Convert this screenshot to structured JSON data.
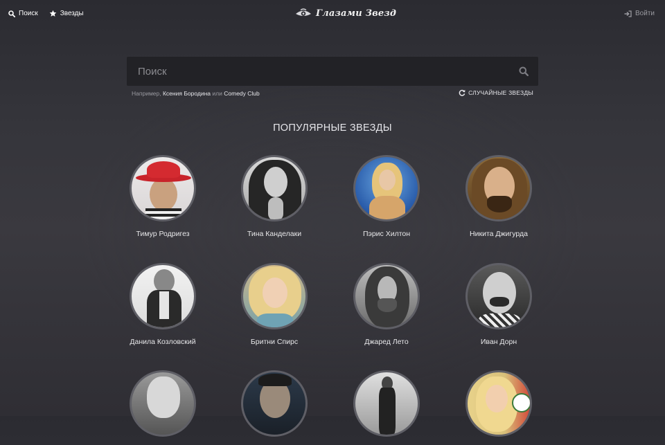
{
  "nav": {
    "search_label": "Поиск",
    "stars_label": "Звезды",
    "logo_text": "Глазами Звезд",
    "login_label": "Войти"
  },
  "search": {
    "placeholder": "Поиск",
    "hint_prefix": "Например,",
    "hint_example1": "Ксения Бородина",
    "hint_or": "или",
    "hint_example2": "Comedy Club",
    "random_label": "СЛУЧАЙНЫЕ ЗВЕЗДЫ"
  },
  "popular": {
    "title": "ПОПУЛЯРНЫЕ ЗВЕЗДЫ",
    "stars": [
      {
        "name": "Тимур Родригез"
      },
      {
        "name": "Тина Канделаки"
      },
      {
        "name": "Пэрис Хилтон"
      },
      {
        "name": "Никита Джигурда"
      },
      {
        "name": "Данила Козловский"
      },
      {
        "name": "Бритни Спирс"
      },
      {
        "name": "Джаред Лето"
      },
      {
        "name": "Иван Дорн"
      },
      {
        "name": ""
      },
      {
        "name": ""
      },
      {
        "name": ""
      },
      {
        "name": ""
      }
    ]
  },
  "colors": {
    "background": "#35353b",
    "search_bg": "#222226",
    "avatar_border": "#5f5f66",
    "text": "#e8e8ea",
    "muted": "#9a9aa0"
  }
}
